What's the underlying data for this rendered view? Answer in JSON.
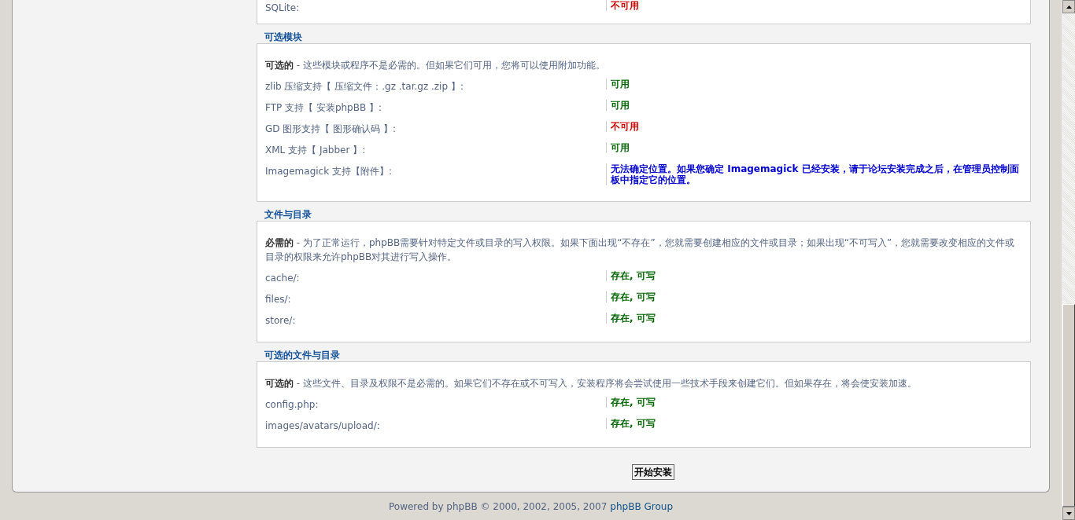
{
  "top_section": {
    "rows": [
      {
        "label": "SQLite:",
        "value": "不可用",
        "kind": "unavailable"
      }
    ]
  },
  "sections": [
    {
      "legend": "可选模块",
      "intro": "**可选的** - 这些模块或程序不是必需的。但如果它们可用，您将可以使用附加功能。",
      "rows": [
        {
          "label": "zlib 压缩支持【 压缩文件：.gz .tar.gz .zip 】:",
          "value": "可用",
          "kind": "available"
        },
        {
          "label": "FTP 支持【 安装phpBB 】:",
          "value": "可用",
          "kind": "available"
        },
        {
          "label": "GD 图形支持【 图形确认码 】:",
          "value": "不可用",
          "kind": "unavailable"
        },
        {
          "label": "XML 支持【 Jabber 】:",
          "value": "可用",
          "kind": "available"
        },
        {
          "label": "Imagemagick 支持【附件】:",
          "value": "无法确定位置。如果您确定 Imagemagick 已经安装，请于论坛安装完成之后，在管理员控制面板中指定它的位置。",
          "kind": "info"
        }
      ]
    },
    {
      "legend": "文件与目录",
      "intro": "**必需的** - 为了正常运行，phpBB需要针对特定文件或目录的写入权限。如果下面出现“不存在”，您就需要创建相应的文件或目录；如果出现“不可写入”，您就需要改变相应的文件或目录的权限来允许phpBB对其进行写入操作。",
      "rows": [
        {
          "label": "cache/:",
          "value": "存在, 可写",
          "kind": "available"
        },
        {
          "label": "files/:",
          "value": "存在, 可写",
          "kind": "available"
        },
        {
          "label": "store/:",
          "value": "存在, 可写",
          "kind": "available"
        }
      ]
    },
    {
      "legend": "可选的文件与目录",
      "intro": "**可选的** - 这些文件、目录及权限不是必需的。如果它们不存在或不可写入，安装程序将会尝试使用一些技术手段来创建它们。但如果存在，将会使安装加速。",
      "rows": [
        {
          "label": "config.php:",
          "value": "存在, 可写",
          "kind": "available"
        },
        {
          "label": "images/avatars/upload/:",
          "value": "存在, 可写",
          "kind": "available"
        }
      ]
    }
  ],
  "submit_button": "开始安装",
  "footer": {
    "text": "Powered by phpBB © 2000, 2002, 2005, 2007",
    "link": "phpBB Group"
  }
}
